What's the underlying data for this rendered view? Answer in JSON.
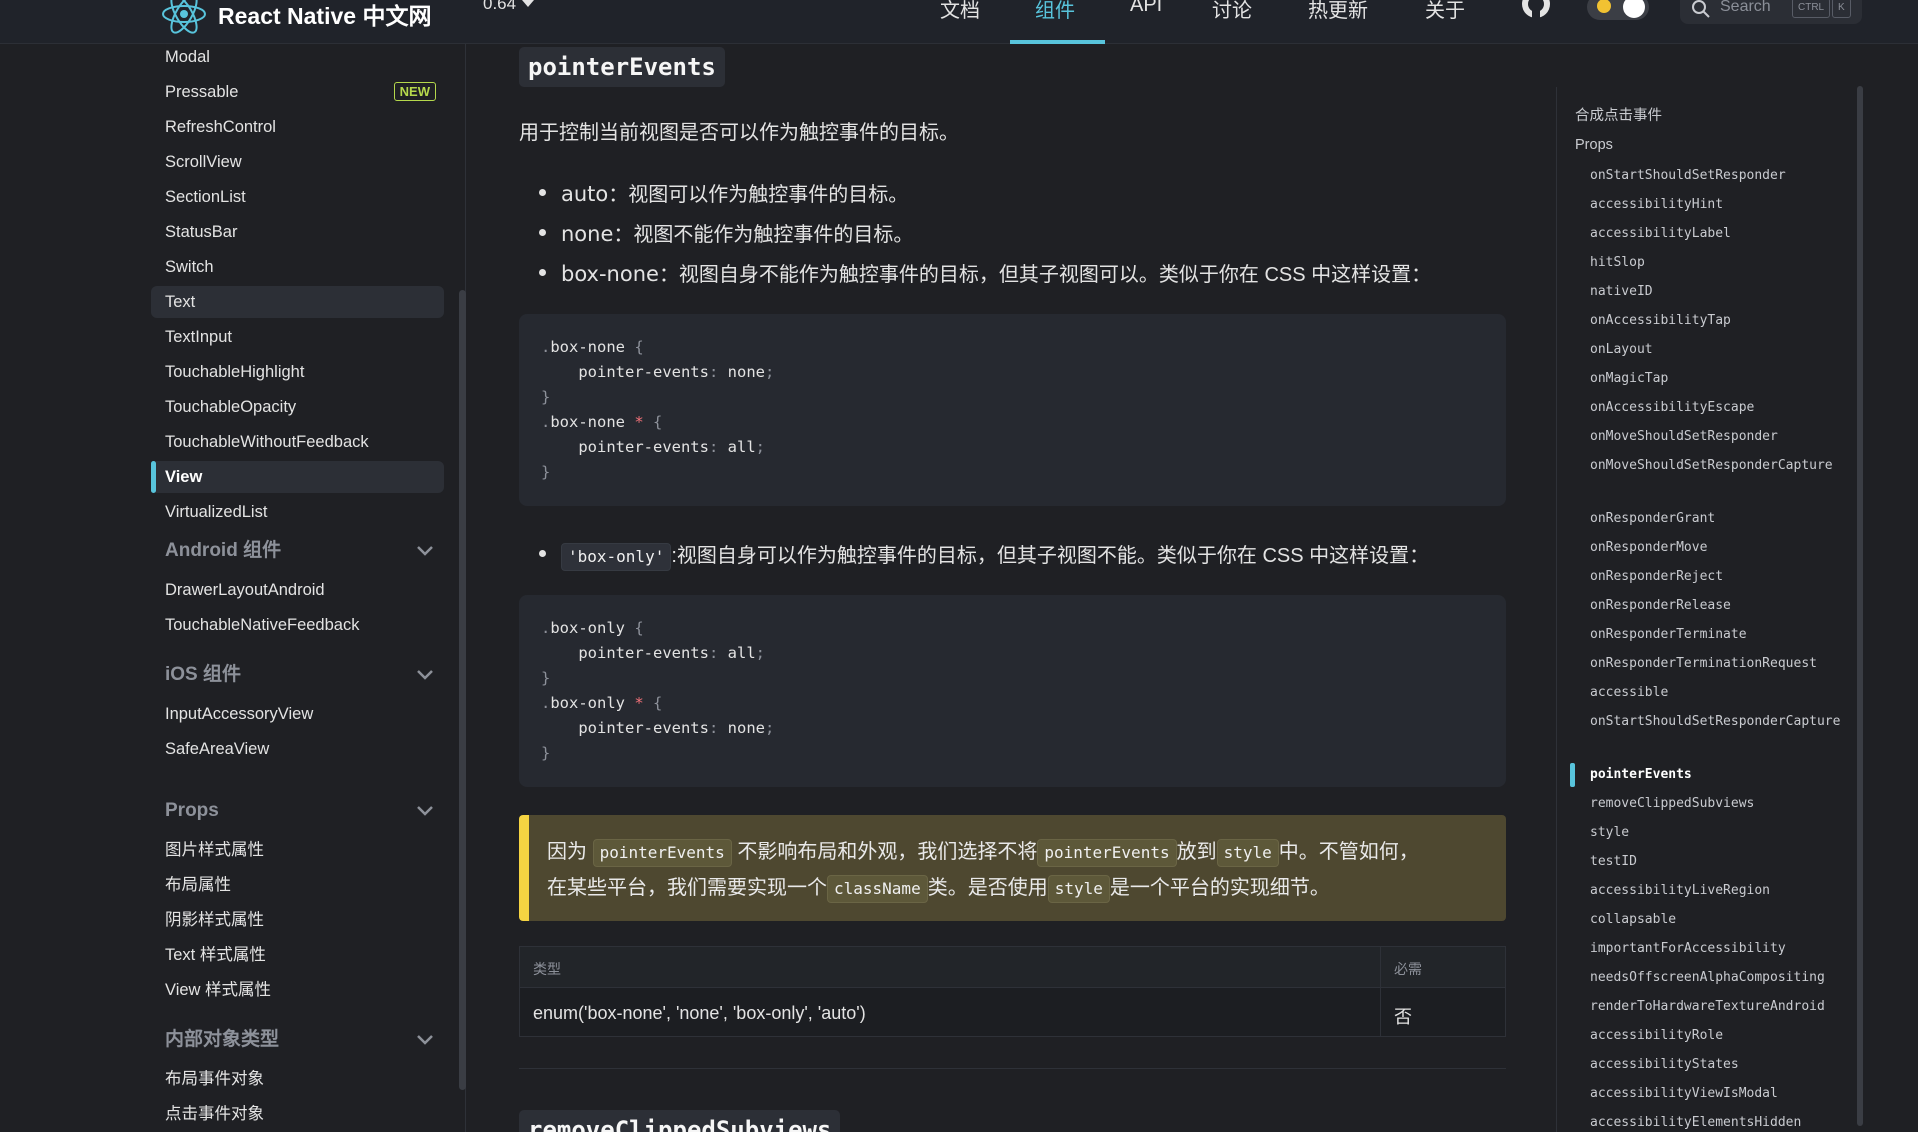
{
  "navbar": {
    "logo_text": "React Native 中文网",
    "version": "0.64",
    "items": [
      "文档",
      "组件",
      "API",
      "讨论",
      "热更新",
      "关于"
    ],
    "active_item": "组件",
    "search_placeholder": "Search",
    "kbd_ctrl": "CTRL",
    "kbd_k": "K"
  },
  "sidebar": {
    "items_top": [
      "Modal",
      "Pressable",
      "RefreshControl",
      "ScrollView",
      "SectionList",
      "StatusBar",
      "Switch",
      "Text",
      "TextInput",
      "TouchableHighlight",
      "TouchableOpacity",
      "TouchableWithoutFeedback",
      "View",
      "VirtualizedList"
    ],
    "new_badge": "NEW",
    "android_title": "Android 组件",
    "android_items": [
      "DrawerLayoutAndroid",
      "TouchableNativeFeedback"
    ],
    "ios_title": "iOS 组件",
    "ios_items": [
      "InputAccessoryView",
      "SafeAreaView"
    ],
    "props_title": "Props",
    "props_items": [
      "图片样式属性",
      "布局属性",
      "阴影样式属性",
      "Text 样式属性",
      "View 样式属性"
    ],
    "internal_title": "内部对象类型",
    "internal_items": [
      "布局事件对象",
      "点击事件对象"
    ]
  },
  "content": {
    "heading": "pointerEvents",
    "intro": "用于控制当前视图是否可以作为触控事件的目标。",
    "bullets": [
      {
        "code": "auto",
        "text": "：视图可以作为触控事件的目标。"
      },
      {
        "code": "none",
        "text": "：视图不能作为触控事件的目标。"
      },
      {
        "code": "box-none",
        "text": "：视图自身不能作为触控事件的目标，但其子视图可以。类似于你在 CSS 中这样设置："
      }
    ],
    "code1": [
      ".box-none {",
      "    pointer-events: none;",
      "}",
      ".box-none * {",
      "    pointer-events: all;",
      "}"
    ],
    "bullet_box_only_code": "'box-only'",
    "bullet_box_only_text": ":视图自身可以作为触控事件的目标，但其子视图不能。类似于你在 CSS 中这样设置：",
    "code2": [
      ".box-only {",
      "    pointer-events: all;",
      "}",
      ".box-only * {",
      "    pointer-events: none;",
      "}"
    ],
    "callout": {
      "l1_a": "因为",
      "l1_code1": "pointerEvents",
      "l1_b": "不影响布局和外观，我们选择不将",
      "l1_code2": "pointerEvents",
      "l1_c": "放到",
      "l1_code3": "style",
      "l1_d": "中。不管如何，",
      "l2_a": "在某些平台，我们需要实现一个",
      "l2_code1": "className",
      "l2_b": "类。是否使用",
      "l2_code2": "style",
      "l2_c": "是一个平台的实现细节。"
    },
    "table": {
      "headers": [
        "类型",
        "必需"
      ],
      "row": [
        "enum('box-none', 'none', 'box-only', 'auto')",
        "否"
      ]
    },
    "next_heading": "removeClippedSubviews"
  },
  "toc": {
    "h1": "合成点击事件",
    "h2": "Props",
    "items": [
      "onStartShouldSetResponder",
      "accessibilityHint",
      "accessibilityLabel",
      "hitSlop",
      "nativeID",
      "onAccessibilityTap",
      "onLayout",
      "onMagicTap",
      "onAccessibilityEscape",
      "onMoveShouldSetResponder",
      "onMoveShouldSetResponderCapture",
      "onResponderGrant",
      "onResponderMove",
      "onResponderReject",
      "onResponderRelease",
      "onResponderTerminate",
      "onResponderTerminationRequest",
      "accessible",
      "onStartShouldSetResponderCapture",
      "pointerEvents",
      "removeClippedSubviews",
      "style",
      "testID",
      "accessibilityLiveRegion",
      "collapsable",
      "importantForAccessibility",
      "needsOffscreenAlphaCompositing",
      "renderToHardwareTextureAndroid",
      "accessibilityRole",
      "accessibilityStates",
      "accessibilityViewIsModal",
      "accessibilityElementsHidden"
    ],
    "active": "pointerEvents"
  },
  "colors": {
    "accent": "#58c4dc",
    "background": "#1f2024",
    "callout_bar": "#f5d442",
    "badge_new": "#b5d84c"
  }
}
